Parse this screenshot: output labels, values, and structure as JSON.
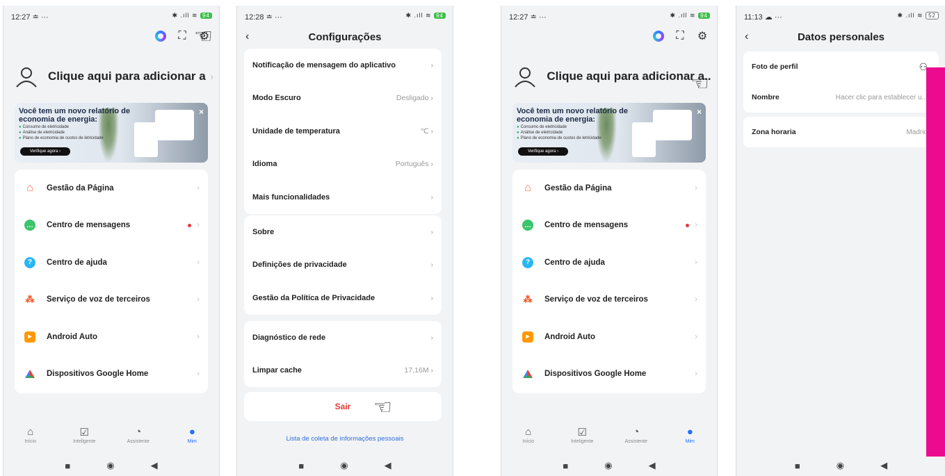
{
  "phone1": {
    "status": {
      "time": "12:27 ≐ ···",
      "icons": "✱ .ıll ≋",
      "battery": "94"
    },
    "profile_text": "Clique aqui para adicionar a...",
    "banner": {
      "title_line1": "Você tem um novo relatório de",
      "title_line2": "economia de energia:",
      "item1": "Consumo de eletricidade",
      "item2": "Análise de eletricidade",
      "item3": "Plano de economia de custos de letricidade",
      "button": "Verifique agora ›"
    },
    "menu": [
      "Gestão da Página",
      "Centro de mensagens",
      "Centro de ajuda",
      "Serviço de voz de terceiros",
      "Android Auto",
      "Dispositivos Google Home"
    ],
    "tabs": [
      "Início",
      "Inteligente",
      "Assistente",
      "Mim"
    ]
  },
  "phone2": {
    "status": {
      "time": "12:28 ≐ ···",
      "icons": "✱ .ıll ≋",
      "battery": "94"
    },
    "title": "Configurações",
    "group1": [
      {
        "label": "Notificação de mensagem do aplicativo",
        "value": ""
      },
      {
        "label": "Modo Escuro",
        "value": "Desligado"
      },
      {
        "label": "Unidade de temperatura",
        "value": "℃"
      },
      {
        "label": "Idioma",
        "value": "Português"
      },
      {
        "label": "Mais funcionalidades",
        "value": ""
      }
    ],
    "group2": [
      {
        "label": "Sobre",
        "value": ""
      },
      {
        "label": "Definições de privacidade",
        "value": ""
      },
      {
        "label": "Gestão da Política de Privacidade",
        "value": ""
      }
    ],
    "group3": [
      {
        "label": "Diagnóstico de rede",
        "value": ""
      },
      {
        "label": "Limpar cache",
        "value": "17,16M"
      }
    ],
    "logout": "Sair",
    "privacy_link": "Lista de coleta de informações pessoais"
  },
  "phone3": {
    "status": {
      "time": "12:27 ≐ ···",
      "icons": "✱ .ıll ≋",
      "battery": "94"
    },
    "profile_text": "Clique aqui para adicionar a..."
  },
  "phone4": {
    "status": {
      "time": "11:13 ☁ ···",
      "icons": "✱ .ıll ≋",
      "battery": "52"
    },
    "title": "Datos personales",
    "rows": [
      {
        "label": "Foto de perfil",
        "value": ""
      },
      {
        "label": "Nombre",
        "value": "Hacer clic para establecer u..."
      },
      {
        "label": "Zona horaria",
        "value": "Madrid"
      }
    ]
  },
  "colors": {
    "accent": "#1e6fff",
    "danger": "#e53935",
    "highlight": "#ec0b8e"
  }
}
